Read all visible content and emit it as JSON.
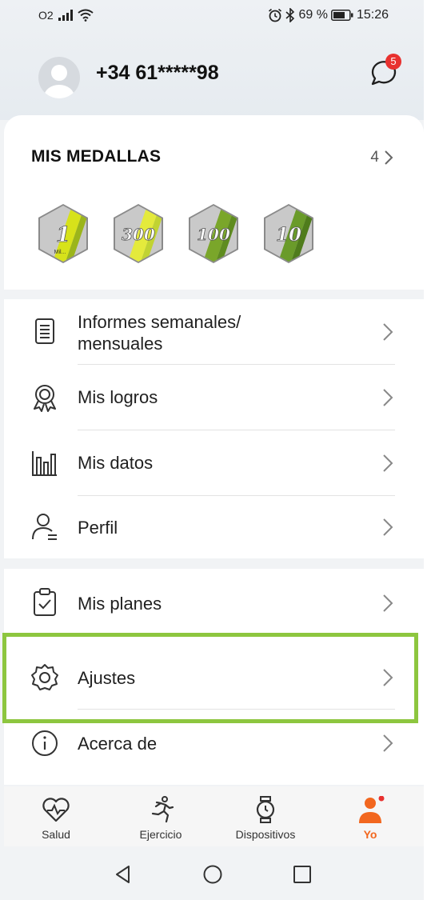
{
  "status_bar": {
    "carrier": "O2",
    "battery_percent": "69 %",
    "time": "15:26",
    "icons": [
      "signal-icon",
      "wifi-icon",
      "alarm-icon",
      "bluetooth-icon",
      "battery-icon"
    ]
  },
  "header": {
    "phone": "+34 61*****98",
    "messages_badge": "5"
  },
  "medals": {
    "title": "MIS MEDALLAS",
    "count": "4",
    "items": [
      {
        "value": "1",
        "caption": "Mil...",
        "colors": [
          "#d7e21a",
          "#9bb51b"
        ]
      },
      {
        "value": "300",
        "caption": "",
        "colors": [
          "#e4ea3c",
          "#c1d332"
        ]
      },
      {
        "value": "100",
        "caption": "",
        "colors": [
          "#7aa62a",
          "#5f8c1f"
        ]
      },
      {
        "value": "10",
        "caption": "",
        "colors": [
          "#6a9b2a",
          "#4f7c1c"
        ]
      }
    ]
  },
  "menu_group1": [
    {
      "label_line1": "Informes semanales/",
      "label_line2": "mensuales",
      "icon": "report-icon"
    },
    {
      "label": "Mis logros",
      "icon": "award-icon"
    },
    {
      "label": "Mis datos",
      "icon": "bar-chart-icon"
    },
    {
      "label": "Perfil",
      "icon": "profile-icon"
    }
  ],
  "menu_group2": [
    {
      "label": "Mis planes",
      "icon": "clipboard-check-icon"
    },
    {
      "label": "Ajustes",
      "icon": "gear-icon"
    },
    {
      "label": "Acerca de",
      "icon": "info-icon"
    }
  ],
  "tabs": [
    {
      "label": "Salud",
      "icon": "heart-icon",
      "active": false
    },
    {
      "label": "Ejercicio",
      "icon": "running-icon",
      "active": false
    },
    {
      "label": "Dispositivos",
      "icon": "watch-icon",
      "active": false
    },
    {
      "label": "Yo",
      "icon": "person-icon",
      "active": true
    }
  ],
  "colors": {
    "accent": "#f2671f",
    "badge": "#e8312f",
    "highlight": "#8dc63f",
    "separator": "#e3e3e3"
  }
}
